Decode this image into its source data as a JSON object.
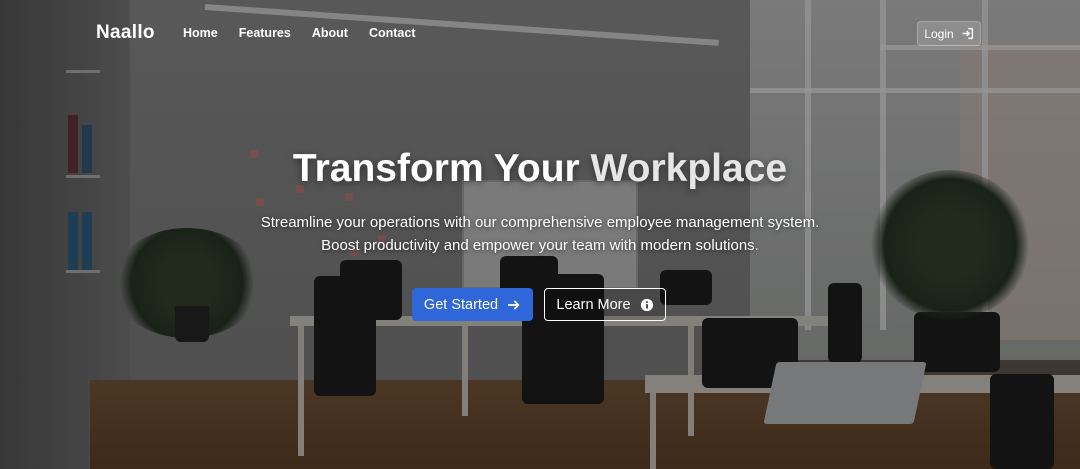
{
  "nav": {
    "brand": "Naallo",
    "links": [
      "Home",
      "Features",
      "About",
      "Contact"
    ],
    "login_label": "Login",
    "login_icon": "sign-in-icon"
  },
  "hero": {
    "title_main": "Transform Your ",
    "title_accent": "Workplace",
    "subtitle": "Streamline your operations with our comprehensive employee management system. Boost productivity and empower your team with modern solutions.",
    "primary_cta": {
      "label": "Get Started",
      "icon": "arrow-right-icon"
    },
    "secondary_cta": {
      "label": "Learn More",
      "icon": "info-circle-icon"
    }
  },
  "colors": {
    "primary": "#2f66d9",
    "text": "#ffffff"
  }
}
